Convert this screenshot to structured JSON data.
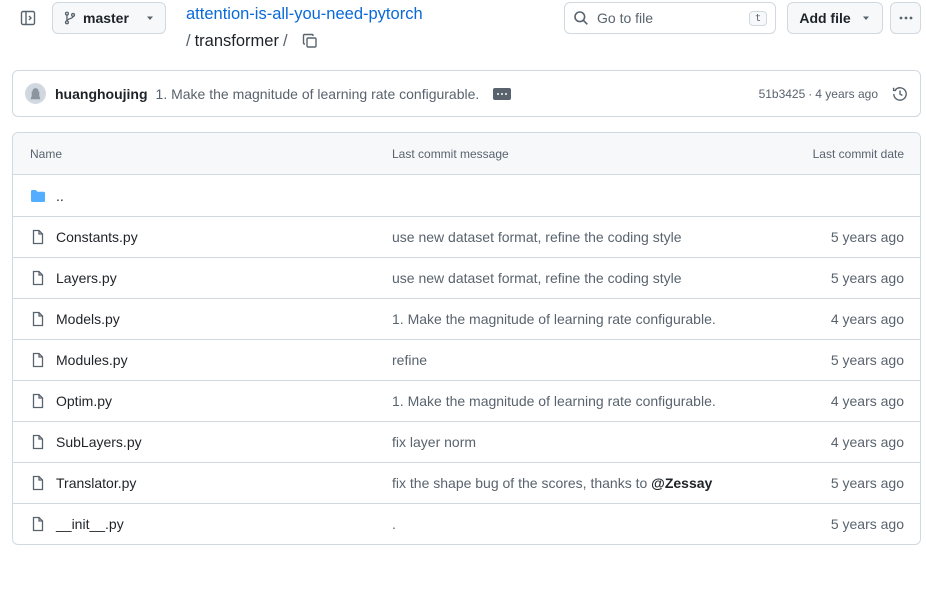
{
  "header": {
    "branch": "master",
    "repo": "attention-is-all-you-need-pytorch",
    "path_segment": "transformer",
    "path_sep": "/",
    "goto_placeholder": "Go to file",
    "goto_kbd": "t",
    "add_file_label": "Add file"
  },
  "commit": {
    "author": "huanghoujing",
    "message": "1. Make the magnitude of learning rate configurable.",
    "sha": "51b3425",
    "dot": "·",
    "age": "4 years ago"
  },
  "table": {
    "headers": {
      "name": "Name",
      "message": "Last commit message",
      "date": "Last commit date"
    },
    "parent_dir": "..",
    "rows": [
      {
        "name": "Constants.py",
        "message": "use new dataset format, refine the coding style",
        "date": "5 years ago"
      },
      {
        "name": "Layers.py",
        "message": "use new dataset format, refine the coding style",
        "date": "5 years ago"
      },
      {
        "name": "Models.py",
        "message": "1. Make the magnitude of learning rate configurable.",
        "date": "4 years ago"
      },
      {
        "name": "Modules.py",
        "message": "refine",
        "date": "5 years ago"
      },
      {
        "name": "Optim.py",
        "message": "1. Make the magnitude of learning rate configurable.",
        "date": "4 years ago"
      },
      {
        "name": "SubLayers.py",
        "message": "fix layer norm",
        "date": "4 years ago"
      },
      {
        "name": "Translator.py",
        "message": "fix the shape bug of the scores, thanks to ",
        "mention": "@Zessay",
        "date": "5 years ago"
      },
      {
        "name": "__init__.py",
        "message": ".",
        "date": "5 years ago"
      }
    ]
  },
  "icons": {
    "sidebar": "sidebar-expand-icon",
    "branch": "git-branch-icon",
    "caret": "triangle-down-icon",
    "copy": "copy-icon",
    "search": "search-icon",
    "more": "kebab-horizontal-icon",
    "history": "history-icon",
    "folder": "folder-icon",
    "file": "file-icon"
  },
  "colors": {
    "link": "#0969da",
    "folder": "#54aeff",
    "border": "#d1d9e0",
    "muted": "#59636e"
  }
}
